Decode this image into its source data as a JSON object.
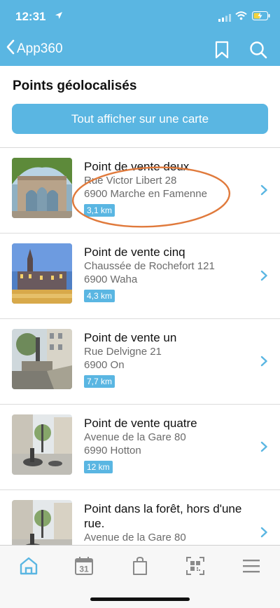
{
  "status_bar": {
    "time": "12:31"
  },
  "nav": {
    "back_label": "App360"
  },
  "page": {
    "section_title": "Points géolocalisés",
    "map_button": "Tout afficher sur une carte"
  },
  "items": [
    {
      "name": "Point de vente deux",
      "street": "Rue Victor Libert 28",
      "city": "6900 Marche en Famenne",
      "distance": "3,1 km"
    },
    {
      "name": "Point de vente cinq",
      "street": "Chaussée de Rochefort 121",
      "city": "6900 Waha",
      "distance": "4,3 km"
    },
    {
      "name": "Point de vente un",
      "street": "Rue Delvigne 21",
      "city": "6900 On",
      "distance": "7,7 km"
    },
    {
      "name": "Point de vente quatre",
      "street": "Avenue de la Gare 80",
      "city": "6990 Hotton",
      "distance": "12 km"
    },
    {
      "name": "Point dans la forêt, hors d'une rue.",
      "street": "Avenue de la Gare 80"
    }
  ],
  "tabs": [
    {
      "icon": "home-icon",
      "active": true
    },
    {
      "icon": "calendar-icon",
      "text": "31"
    },
    {
      "icon": "shopping-bag-icon"
    },
    {
      "icon": "qr-code-icon"
    },
    {
      "icon": "menu-icon"
    }
  ],
  "colors": {
    "accent": "#5ab6e2",
    "highlight_circle": "#e07a3c"
  }
}
